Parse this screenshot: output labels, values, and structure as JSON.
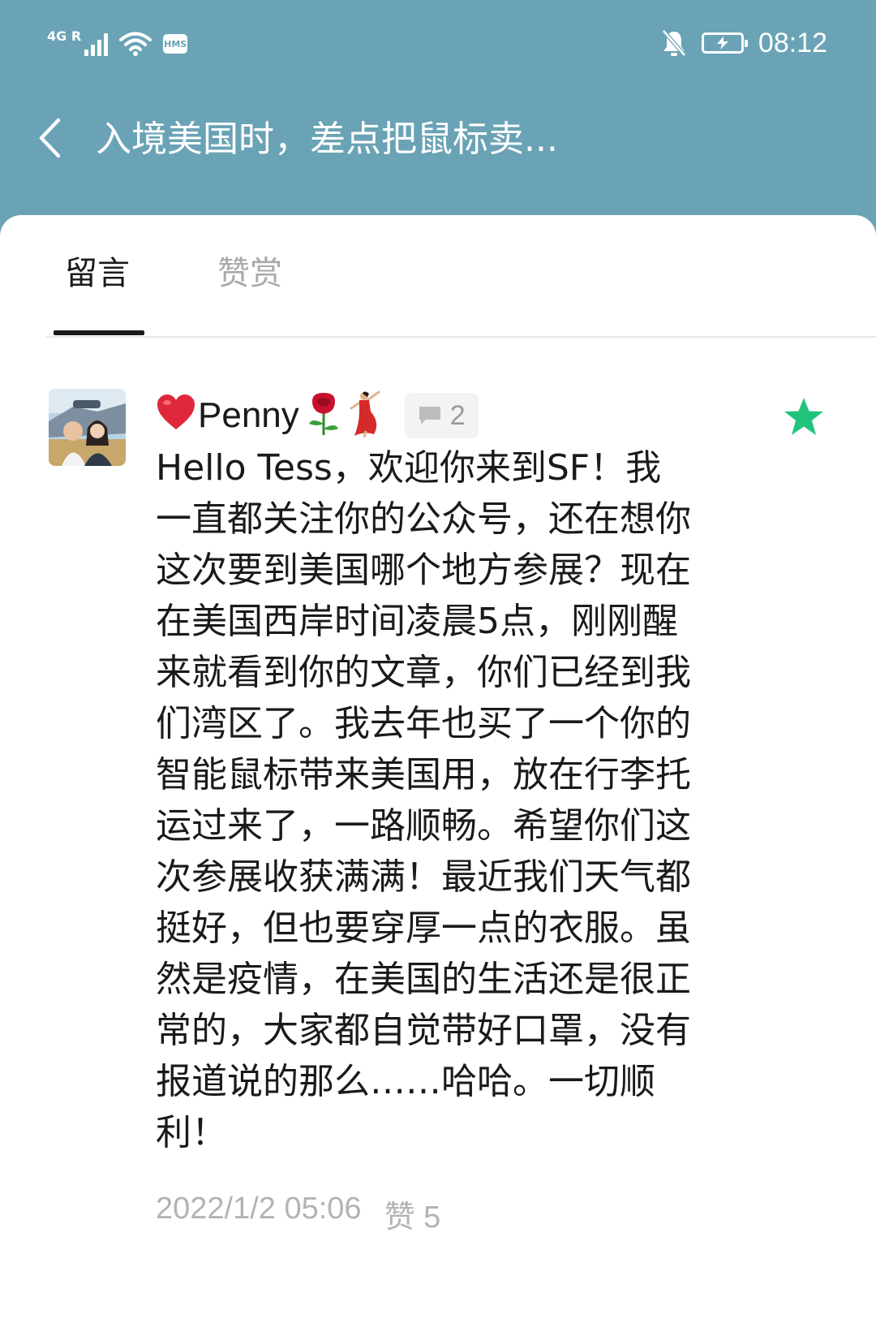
{
  "status_bar": {
    "network": "4G R",
    "hms_badge": "HMS",
    "time": "08:12",
    "icons": [
      "signal-icon",
      "wifi-icon",
      "hms-icon",
      "mute-bell-icon",
      "battery-charging-icon"
    ]
  },
  "header": {
    "title": "入境美国时，差点把鼠标卖...",
    "back_icon": "chevron-left-icon"
  },
  "tabs": [
    {
      "label": "留言",
      "active": true
    },
    {
      "label": "赞赏",
      "active": false
    }
  ],
  "comment": {
    "username": "Penny",
    "name_prefix_icon": "heart-icon",
    "name_suffix_icons": [
      "rose-icon",
      "dancer-icon"
    ],
    "reply_count": "2",
    "starred_icon": "star-icon",
    "colors": {
      "star": "#21c47a",
      "heart": "#e0283a"
    },
    "text": "Hello Tess，欢迎你来到SF！我一直都关注你的公众号，还在想你这次要到美国哪个地方参展？现在在美国西岸时间凌晨5点，刚刚醒来就看到你的文章，你们已经到我们湾区了。我去年也买了一个你的智能鼠标带来美国用，放在行李托运过来了，一路顺畅。希望你们这次参展收获满满！最近我们天气都挺好，但也要穿厚一点的衣服。虽然是疫情，在美国的生活还是很正常的，大家都自觉带好口罩，没有报道说的那么……哈哈。一切顺利！",
    "timestamp": "2022/1/2 05:06",
    "likes_label": "赞 5"
  },
  "theme": {
    "header_bg": "#6aa3b5",
    "text": "#1a1a1a",
    "muted": "#b3b3b3"
  }
}
